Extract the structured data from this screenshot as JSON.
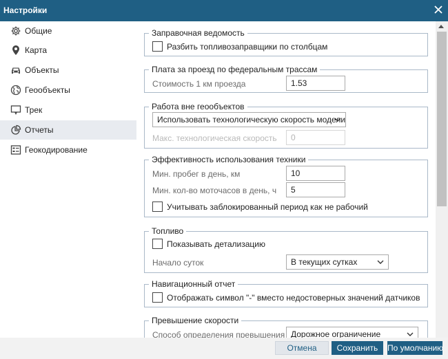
{
  "window": {
    "title": "Настройки"
  },
  "sidebar": {
    "items": [
      {
        "label": "Общие",
        "icon": "gear-icon",
        "active": false
      },
      {
        "label": "Карта",
        "icon": "map-pin-icon",
        "active": false
      },
      {
        "label": "Объекты",
        "icon": "car-icon",
        "active": false
      },
      {
        "label": "Геообъекты",
        "icon": "globe-icon",
        "active": false
      },
      {
        "label": "Трек",
        "icon": "track-icon",
        "active": false
      },
      {
        "label": "Отчеты",
        "icon": "pie-chart-icon",
        "active": true
      },
      {
        "label": "Геокодирование",
        "icon": "geocoding-icon",
        "active": false
      }
    ]
  },
  "sections": {
    "fuel_sheet": {
      "title": "Заправочная ведомость",
      "split_checkbox": "Разбить топливозаправщики по столбцам"
    },
    "toll": {
      "title": "Плата за проезд по федеральным трассам",
      "cost_label": "Стоимость 1 км проезда",
      "cost_value": "1.53"
    },
    "outside_geo": {
      "title": "Работа вне геообъектов",
      "speed_select": "Использовать технологическую скорость модели",
      "max_speed_label": "Макс. технологическая скорость",
      "max_speed_value": "0"
    },
    "efficiency": {
      "title": "Эффективность использования техники",
      "min_mileage_label": "Мин. пробег в день, км",
      "min_mileage_value": "10",
      "min_hours_label": "Мин. кол-во моточасов в день, ч",
      "min_hours_value": "5",
      "blocked_checkbox": "Учитывать заблокированный период как не рабочий"
    },
    "fuel": {
      "title": "Топливо",
      "details_checkbox": "Показывать детализацию",
      "day_start_label": "Начало суток",
      "day_start_value": "В текущих сутках"
    },
    "nav_report": {
      "title": "Навигационный отчет",
      "dash_checkbox": "Отображать символ \"-\" вместо недостоверных значений датчиков"
    },
    "overspeed": {
      "title": "Превышение скорости",
      "method_label": "Способ определения превышения",
      "method_value": "Дорожное ограничение"
    }
  },
  "footer": {
    "cancel": "Отмена",
    "save": "Сохранить",
    "default": "По умолчанию"
  },
  "colors": {
    "accent": "#1f5f84",
    "active_row": "#e8ebf0",
    "border": "#a9b8c8"
  }
}
